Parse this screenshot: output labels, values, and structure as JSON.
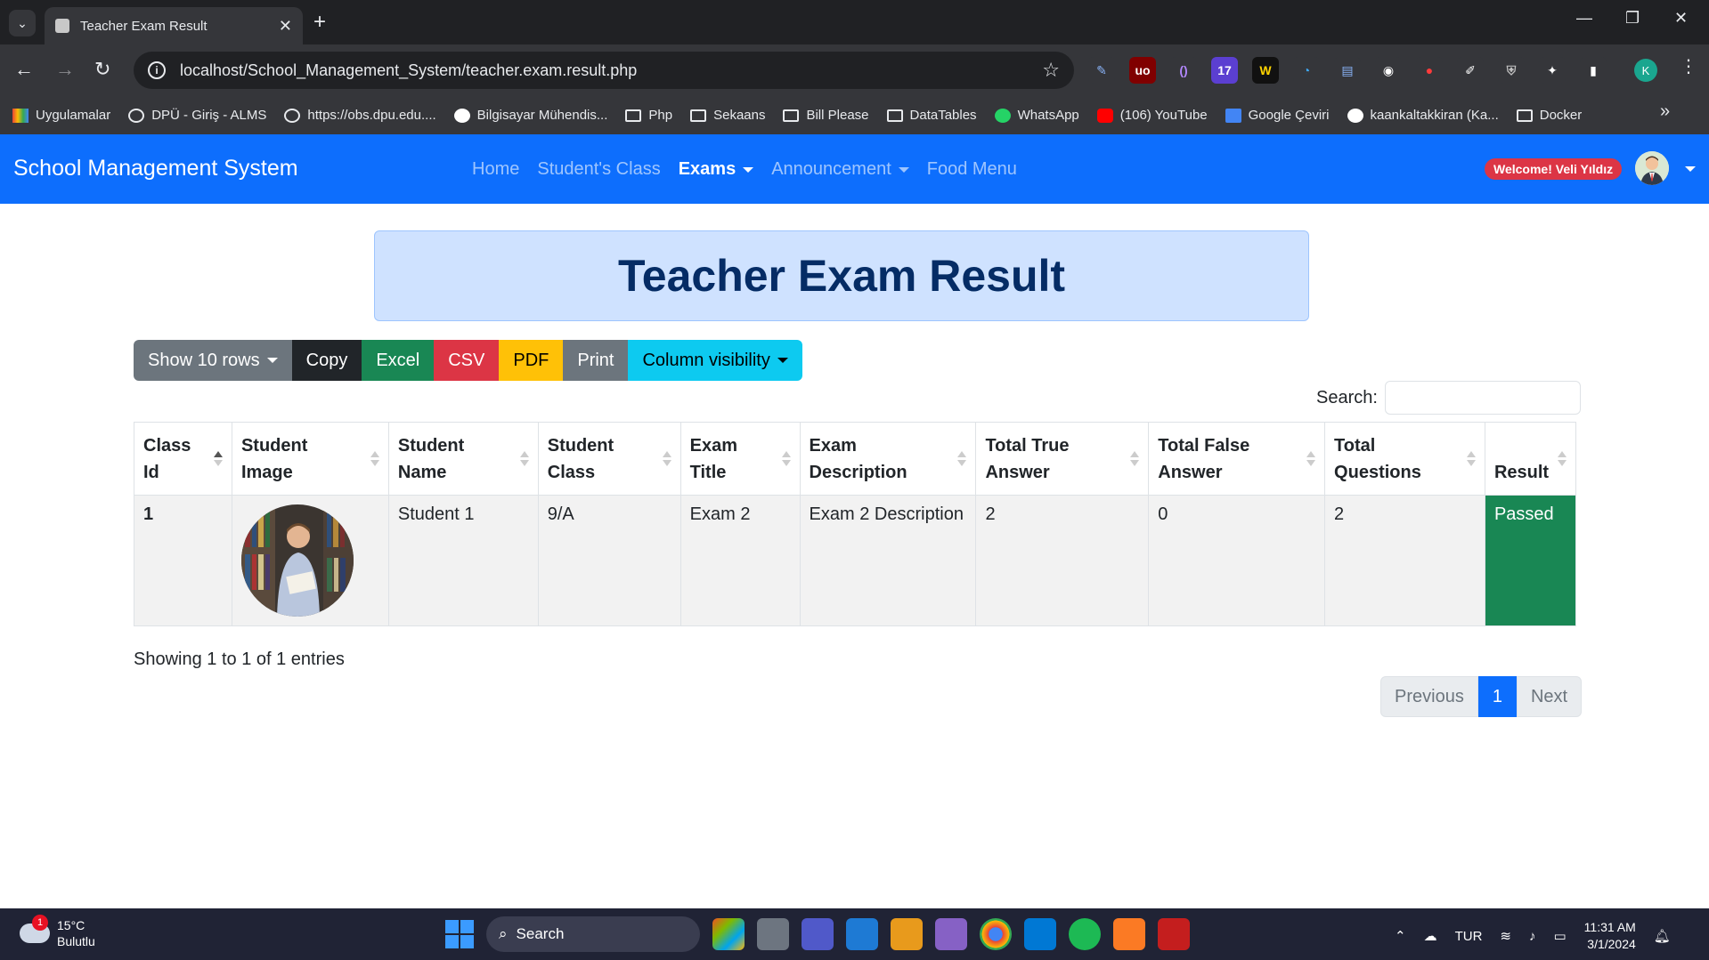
{
  "browser": {
    "tab_title": "Teacher Exam Result",
    "url": "localhost/School_Management_System/teacher.exam.result.php",
    "bookmarks": [
      "Uygulamalar",
      "DPÜ - Giriş - ALMS",
      "https://obs.dpu.edu....",
      "Bilgisayar Mühendis...",
      "Php",
      "Sekaans",
      "Bill Please",
      "DataTables",
      "WhatsApp",
      "(106) YouTube",
      "Google Çeviri",
      "kaankaltakkiran (Ka...",
      "Docker"
    ],
    "profile_initial": "K"
  },
  "navbar": {
    "brand": "School Management System",
    "items": [
      "Home",
      "Student's Class",
      "Exams",
      "Announcement",
      "Food Menu"
    ],
    "welcome": "Welcome! Veli Yıldız"
  },
  "page": {
    "title": "Teacher Exam Result",
    "buttons": {
      "show_rows": "Show 10 rows",
      "copy": "Copy",
      "excel": "Excel",
      "csv": "CSV",
      "pdf": "PDF",
      "print": "Print",
      "column_visibility": "Column visibility"
    },
    "search_label": "Search:",
    "table": {
      "headers": [
        "Class Id",
        "Student Image",
        "Student Name",
        "Student Class",
        "Exam Title",
        "Exam Description",
        "Total True Answer",
        "Total False Answer",
        "Total Questions",
        "Result"
      ],
      "rows": [
        {
          "class_id": "1",
          "student_name": "Student 1",
          "student_class": "9/A",
          "exam_title": "Exam 2",
          "exam_description": "Exam 2 Description",
          "true_answer": "2",
          "false_answer": "0",
          "total_questions": "2",
          "result": "Passed"
        }
      ]
    },
    "info": "Showing 1 to 1 of 1 entries",
    "pager": {
      "previous": "Previous",
      "current": "1",
      "next": "Next"
    }
  },
  "taskbar": {
    "temperature": "15°C",
    "weather": "Bulutlu",
    "weather_badge": "1",
    "search": "Search",
    "language": "TUR",
    "time": "11:31 AM",
    "date": "3/1/2024"
  }
}
